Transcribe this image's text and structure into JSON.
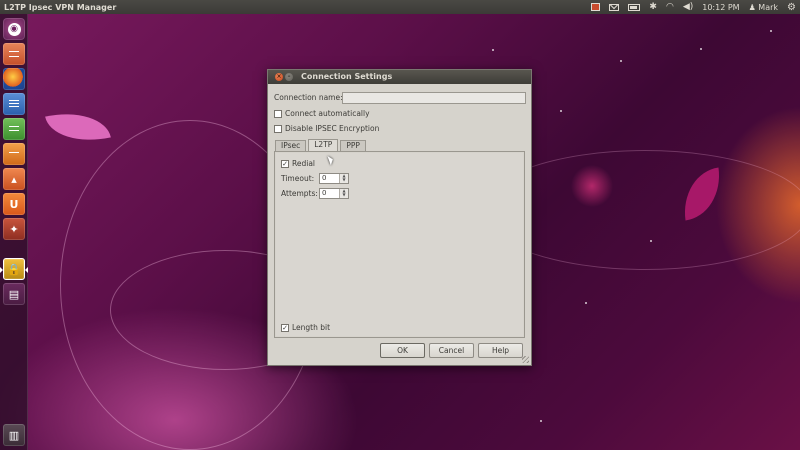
{
  "top_panel": {
    "app_title": "L2TP Ipsec VPN Manager",
    "clock": "10:12 PM",
    "user": "Mark"
  },
  "launcher": {
    "items": [
      "dash",
      "files",
      "firefox",
      "libreoffice-writer",
      "libreoffice-calc",
      "libreoffice-impress",
      "software-center",
      "ubuntu-one",
      "system-settings",
      "l2tp-ipsec-vpn",
      "terminal",
      "trash"
    ]
  },
  "dialog": {
    "title": "Connection Settings",
    "connection_name_label": "Connection name:",
    "connection_name_value": "",
    "connect_automatically": {
      "label": "Connect automatically",
      "checked": false
    },
    "disable_ipsec": {
      "label": "Disable IPSEC Encryption",
      "checked": false
    },
    "tabs": [
      {
        "label": "IPsec",
        "active": false
      },
      {
        "label": "L2TP",
        "active": true
      },
      {
        "label": "PPP",
        "active": false
      }
    ],
    "l2tp": {
      "redial": {
        "label": "Redial",
        "checked": true
      },
      "timeout_label": "Timeout:",
      "timeout_value": "0",
      "attempts_label": "Attempts:",
      "attempts_value": "0",
      "length_bit": {
        "label": "Length bit",
        "checked": true
      }
    },
    "buttons": {
      "ok": "OK",
      "cancel": "Cancel",
      "help": "Help"
    }
  }
}
